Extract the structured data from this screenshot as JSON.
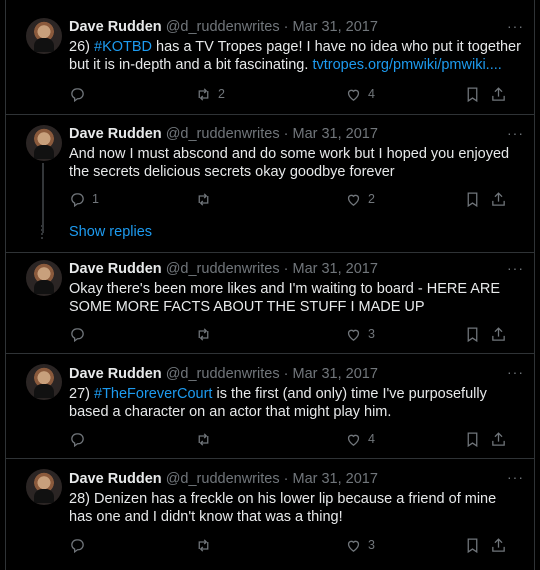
{
  "tweets": [
    {
      "name": "Dave Rudden",
      "handle": "@d_ruddenwrites",
      "sep": "·",
      "date": "Mar 31, 2017",
      "text_prefix": "26) ",
      "link1": "#KOTBD",
      "text_middle": " has a TV Tropes page! I have no idea who put it together but it is in-depth and a bit fascinating. ",
      "link2": "tvtropes.org/pmwiki/pmwiki....",
      "replies": "",
      "retweets": "2",
      "likes": "4"
    },
    {
      "name": "Dave Rudden",
      "handle": "@d_ruddenwrites",
      "sep": "·",
      "date": "Mar 31, 2017",
      "text": "And now I must abscond and do some work but I hoped you enjoyed the secrets delicious secrets okay goodbye forever",
      "replies": "1",
      "retweets": "",
      "likes": "2"
    },
    {
      "name": "Dave Rudden",
      "handle": "@d_ruddenwrites",
      "sep": "·",
      "date": "Mar 31, 2017",
      "text": "Okay there's been more likes and I'm waiting to board - HERE ARE SOME MORE FACTS ABOUT THE STUFF I MADE UP",
      "replies": "",
      "retweets": "",
      "likes": "3"
    },
    {
      "name": "Dave Rudden",
      "handle": "@d_ruddenwrites",
      "sep": "·",
      "date": "Mar 31, 2017",
      "text_prefix": "27) ",
      "link1": "#TheForeverCourt",
      "text_middle": " is the first (and only) time I've purposefully based a character on an actor that might play him.",
      "replies": "",
      "retweets": "",
      "likes": "4"
    },
    {
      "name": "Dave Rudden",
      "handle": "@d_ruddenwrites",
      "sep": "·",
      "date": "Mar 31, 2017",
      "text": "28) Denizen has a freckle on his lower lip because a friend of mine has one and I didn't know that was a thing!",
      "replies": "",
      "retweets": "",
      "likes": "3"
    }
  ],
  "show_replies": "Show replies",
  "more_glyph": "···",
  "icons": [
    "reply-icon",
    "retweet-icon",
    "like-icon",
    "bookmark-icon",
    "share-icon",
    "more-icon"
  ],
  "colors": {
    "background": "#000000",
    "text": "#e7e9ea",
    "muted": "#71767b",
    "link": "#1d9bf0",
    "border": "#2f3336"
  }
}
